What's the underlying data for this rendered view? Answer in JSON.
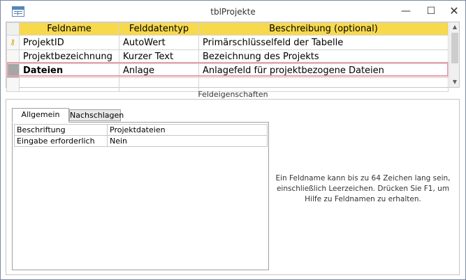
{
  "window": {
    "title": "tblProjekte",
    "controls": {
      "minimize": "—",
      "maximize": "☐",
      "close": "✕"
    }
  },
  "grid": {
    "columns": [
      "Feldname",
      "Felddatentyp",
      "Beschreibung (optional)"
    ],
    "rows": [
      {
        "name": "ProjektID",
        "type": "AutoWert",
        "description": "Primärschlüsselfeld der Tabelle",
        "primary_key": true
      },
      {
        "name": "Projektbezeichnung",
        "type": "Kurzer Text",
        "description": "Bezeichnung des Projekts",
        "primary_key": false
      },
      {
        "name": "Dateien",
        "type": "Anlage",
        "description": "Anlagefeld für projektbezogene Dateien",
        "selected": true
      },
      {
        "name": "",
        "type": "",
        "description": ""
      }
    ]
  },
  "properties": {
    "section_title": "Feldeigenschaften",
    "tabs": [
      {
        "label": "Allgemein",
        "active": true
      },
      {
        "label": "Nachschlagen",
        "active": false
      }
    ],
    "items": [
      {
        "label": "Beschriftung",
        "value": "Projektdateien"
      },
      {
        "label": "Eingabe erforderlich",
        "value": "Nein"
      }
    ],
    "help_text": "Ein Feldname kann bis zu 64 Zeichen lang sein, einschließlich Leerzeichen. Drücken Sie F1, um Hilfe zu Feldnamen zu erhalten."
  },
  "colors": {
    "header_bg": "#f7d94c",
    "selection_outline": "#e8a0a8",
    "row_selector_selected": "#a6a6a6",
    "key_icon": "#c8a400"
  }
}
